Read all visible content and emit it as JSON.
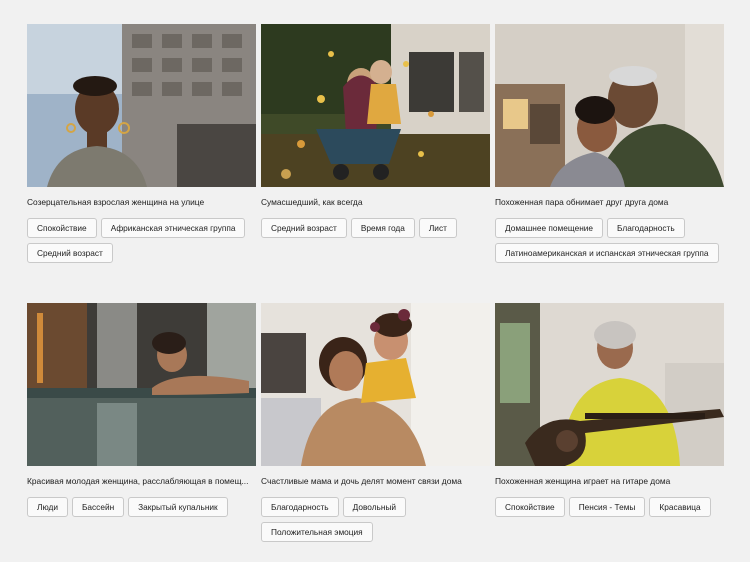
{
  "cards": [
    {
      "caption": "Созерцательная взрослая женщина на улице",
      "tags": [
        "Спокойствие",
        "Африканская этническая группа",
        "Средний возраст"
      ]
    },
    {
      "caption": "Сумасшедший, как всегда",
      "tags": [
        "Средний возраст",
        "Время года",
        "Лист"
      ]
    },
    {
      "caption": "Похоженная пара обнимает друг друга дома",
      "tags": [
        "Домашнее помещение",
        "Благодарность",
        "Латиноамериканская и испанская этническая группа"
      ]
    },
    {
      "caption": "Красивая молодая женщина, расслабляющая в помещ...",
      "tags": [
        "Люди",
        "Бассейн",
        "Закрытый купальник"
      ]
    },
    {
      "caption": "Счастливые мама и дочь делят момент связи дома",
      "tags": [
        "Благодарность",
        "Довольный",
        "Положительная эмоция"
      ]
    },
    {
      "caption": "Похоженная женщина играет на гитаре дома",
      "tags": [
        "Спокойствие",
        "Пенсия - Темы",
        "Красавица"
      ]
    }
  ]
}
